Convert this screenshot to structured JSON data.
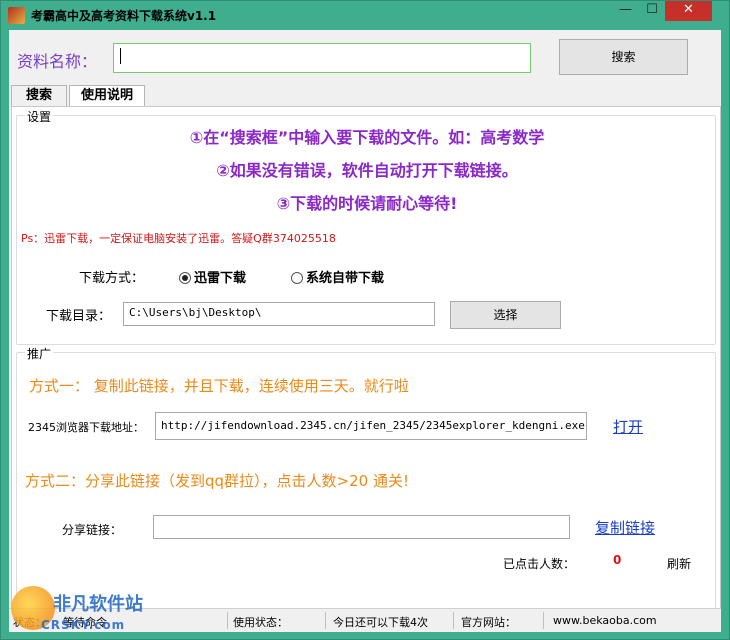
{
  "window": {
    "title": "考霸高中及高考资料下载系统v1.1",
    "min": "—",
    "max": "☐",
    "close": "✕"
  },
  "search": {
    "label": "资料名称：",
    "value": "",
    "button": "搜索"
  },
  "tabs": [
    {
      "label": "搜索"
    },
    {
      "label": "使用说明"
    }
  ],
  "settings": {
    "legend": "设置",
    "instructions": [
      "①在“搜索框”中输入要下载的文件。如：高考数学",
      "②如果没有错误，软件自动打开下载链接。",
      "③下载的时候请耐心等待!"
    ],
    "ps": "Ps：迅雷下载，一定保证电脑安装了迅雷。答疑Q群374025518",
    "method_label": "下载方式：",
    "method_options": [
      {
        "label": "迅雷下载",
        "selected": true
      },
      {
        "label": "系统自带下载",
        "selected": false
      }
    ],
    "dir_label": "下载目录：",
    "dir_value": "C:\\Users\\bj\\Desktop\\",
    "choose_button": "选择"
  },
  "promo": {
    "legend": "推广",
    "way1": "方式一：  复制此链接，并且下载，连续使用三天。就行啦",
    "browser_label": "2345浏览器下载地址：",
    "browser_url": "http://jifendownload.2345.cn/jifen_2345/2345explorer_kdengni.exe",
    "open_link": "打开",
    "way2": "方式二：分享此链接（发到qq群拉），点击人数>20 通关!",
    "share_label": "分享链接：",
    "share_value": "",
    "copy_link": "复制链接",
    "clicks_label": "已点击人数：",
    "clicks_value": "0",
    "refresh_link": "刷新"
  },
  "status": {
    "state_label": "状态：",
    "state_value": "等待命令",
    "use_label": "使用状态：",
    "use_value": "今日还可以下载4次",
    "site_label": "官方网站：",
    "site_value": "www.bekaoba.com"
  },
  "watermark": {
    "name": "非凡软件站",
    "sub": "CRSKY.com"
  }
}
